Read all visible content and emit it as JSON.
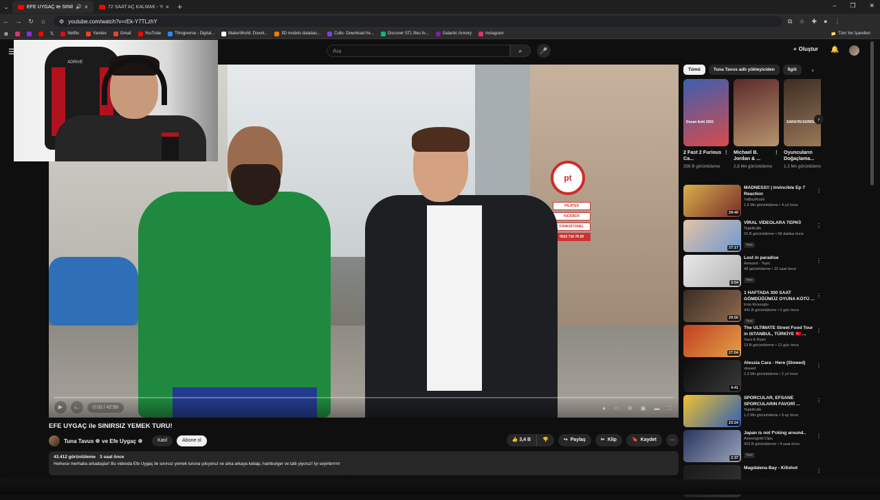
{
  "browser": {
    "tabs": [
      {
        "title": "EFE UYGAÇ ile SINIRSIZ YE...",
        "active": true
      },
      {
        "title": "72 SAAT AÇ KALMAK - YouTub...",
        "active": false
      }
    ],
    "url": "youtube.com/watch?v=rEk-Y7TLzhY",
    "bookmarks": [
      {
        "label": "",
        "color": "#e1306c"
      },
      {
        "label": "",
        "color": "#8a2be2"
      },
      {
        "label": "",
        "color": "#ff0000"
      },
      {
        "label": "",
        "color": "#ffffff"
      },
      {
        "label": "Netflix",
        "color": "#e50914"
      },
      {
        "label": "Yandex",
        "color": "#fc3f1d"
      },
      {
        "label": "Gmail",
        "color": "#ea4335"
      },
      {
        "label": "YouTube",
        "color": "#ff0000"
      },
      {
        "label": "Thingiverse - Digital...",
        "color": "#248bfb"
      },
      {
        "label": "MakerWorld: Downl...",
        "color": "#ffffff"
      },
      {
        "label": "3D models databas...",
        "color": "#f57c00"
      },
      {
        "label": "Cults- Download fre...",
        "color": "#7b3fe4"
      },
      {
        "label": "Discover STL files fo...",
        "color": "#00b894"
      },
      {
        "label": "Galactic Armory",
        "color": "#7a1fa2"
      },
      {
        "label": "Instagram",
        "color": "#e1306c"
      }
    ],
    "all_bookmarks": "Tüm Yer İşaretleri"
  },
  "header": {
    "search_placeholder": "Ara",
    "create_label": "Oluştur"
  },
  "video": {
    "title": "EFE UYGAÇ ile SINIRSIZ YEMEK TURU!",
    "progress": 0.0,
    "time": "0:00 / 42:58"
  },
  "channel": {
    "name1": "Tuna Tavus",
    "name2": "ve Efe Uygaç",
    "join": "Katıl",
    "subscribe": "Abone ol"
  },
  "actions": {
    "likes": "3,4 B",
    "share": "Paylaş",
    "clip": "Klip",
    "save": "Kaydet"
  },
  "description": {
    "views": "43.412 görüntüleme",
    "age": "3 saat önce",
    "text": "Herkese merhaba arkadaşlar! Bu videoda Efe Uygaç ile sınırsız yemek turuna çıkıyoruz ve arka arkaya kebap, hamburger ve tatlı yiyoruz! İyi seyirlerrrrrr"
  },
  "sidebar": {
    "chips": [
      "Tümü",
      "Tuna Tavus adlı yükleyiciden",
      "İlgili"
    ],
    "shorts": [
      {
        "title": "2 Fast 2 Furious Ca...",
        "views": "356 B görüntüleme",
        "thumb_caption": "Duvan Aoki 2003",
        "colors": [
          "#3b5fb0",
          "#d94b4b"
        ]
      },
      {
        "title": "Michael B. Jordan & ...",
        "views": "2,8 Mn görüntüleme",
        "thumb_caption": "",
        "colors": [
          "#5c2a2a",
          "#b7946e"
        ]
      },
      {
        "title": "Oyuncuların Doğaçlama...",
        "views": "1,3 Mn görüntüleme",
        "thumb_caption": "SARAYIN EURIDON",
        "colors": [
          "#3c2d22",
          "#9c7b5a"
        ]
      }
    ],
    "videos": [
      {
        "title": "MADNESS!! | Invincible Ep 7 Reaction",
        "channel": "YaBoyRoshi",
        "meta": "1,6 Mn görüntüleme • 4 yıl önce",
        "duration": "29:40",
        "badge": "",
        "colors": [
          "#d8b04a",
          "#7a2c2c"
        ]
      },
      {
        "title": "VİRAL VİDEOLARA TEPKİ!",
        "channel": "TepkiKolik",
        "meta": "15 B görüntüleme • 58 dakika önce",
        "duration": "27:17",
        "badge": "Yeni",
        "colors": [
          "#e3c3a6",
          "#6f98d1"
        ]
      },
      {
        "title": "Lost in paradise",
        "channel": "Amazed - Topic",
        "meta": "48 görüntüleme • 22 saat önce",
        "duration": "3:54",
        "badge": "Yeni",
        "colors": [
          "#e8e8e8",
          "#b5b5b5"
        ]
      },
      {
        "title": "1 HAFTADA 300 SAAT GÖMDÜĞÜMÜZ OYUNA KÖTÜ ...",
        "channel": "Enis Kirazoglu",
        "meta": "441 B görüntüleme • 2 gün önce",
        "duration": "29:50",
        "badge": "Yeni",
        "colors": [
          "#3a2c24",
          "#8f6b4f"
        ]
      },
      {
        "title": "The ULTIMATE Street Food Tour in ISTANBUL, TÜRKİYE 🇹🇷 ...",
        "channel": "Sara & Ryan",
        "meta": "13 B görüntüleme • 12 gün önce",
        "duration": "27:04",
        "badge": "",
        "colors": [
          "#c2401f",
          "#e2a04a"
        ]
      },
      {
        "title": "Alessia Cara - Here (Slowed)",
        "channel": "slowed",
        "meta": "2,3 Mn görüntüleme • 2 yıl önce",
        "duration": "4:41",
        "badge": "",
        "colors": [
          "#0d0d0d",
          "#3a3a3a"
        ]
      },
      {
        "title": "SPORCULAR, EFSANE SPORCULARIN FAVORİ ...",
        "channel": "TepkiKolik",
        "meta": "1,2 Mn görüntüleme • 9 ay önce",
        "duration": "23:24",
        "badge": "",
        "colors": [
          "#f2c230",
          "#2e5fb8"
        ]
      },
      {
        "title": "Japan is not f*cking around..",
        "channel": "Asmongold Clips",
        "meta": "415 B görüntüleme • 4 saat önce",
        "duration": "2:37",
        "badge": "Yeni",
        "colors": [
          "#2a3560",
          "#9aa3b8"
        ]
      },
      {
        "title": "Magdalena Bay - Killshot",
        "channel": "",
        "meta": "",
        "duration": "",
        "badge": "",
        "colors": [
          "#1a1a1a",
          "#333333"
        ]
      }
    ]
  },
  "icons": {
    "like": "thumbs-up-icon",
    "dislike": "thumbs-down-icon",
    "share": "share-icon",
    "clip": "scissors-icon",
    "save": "bookmark-icon"
  }
}
